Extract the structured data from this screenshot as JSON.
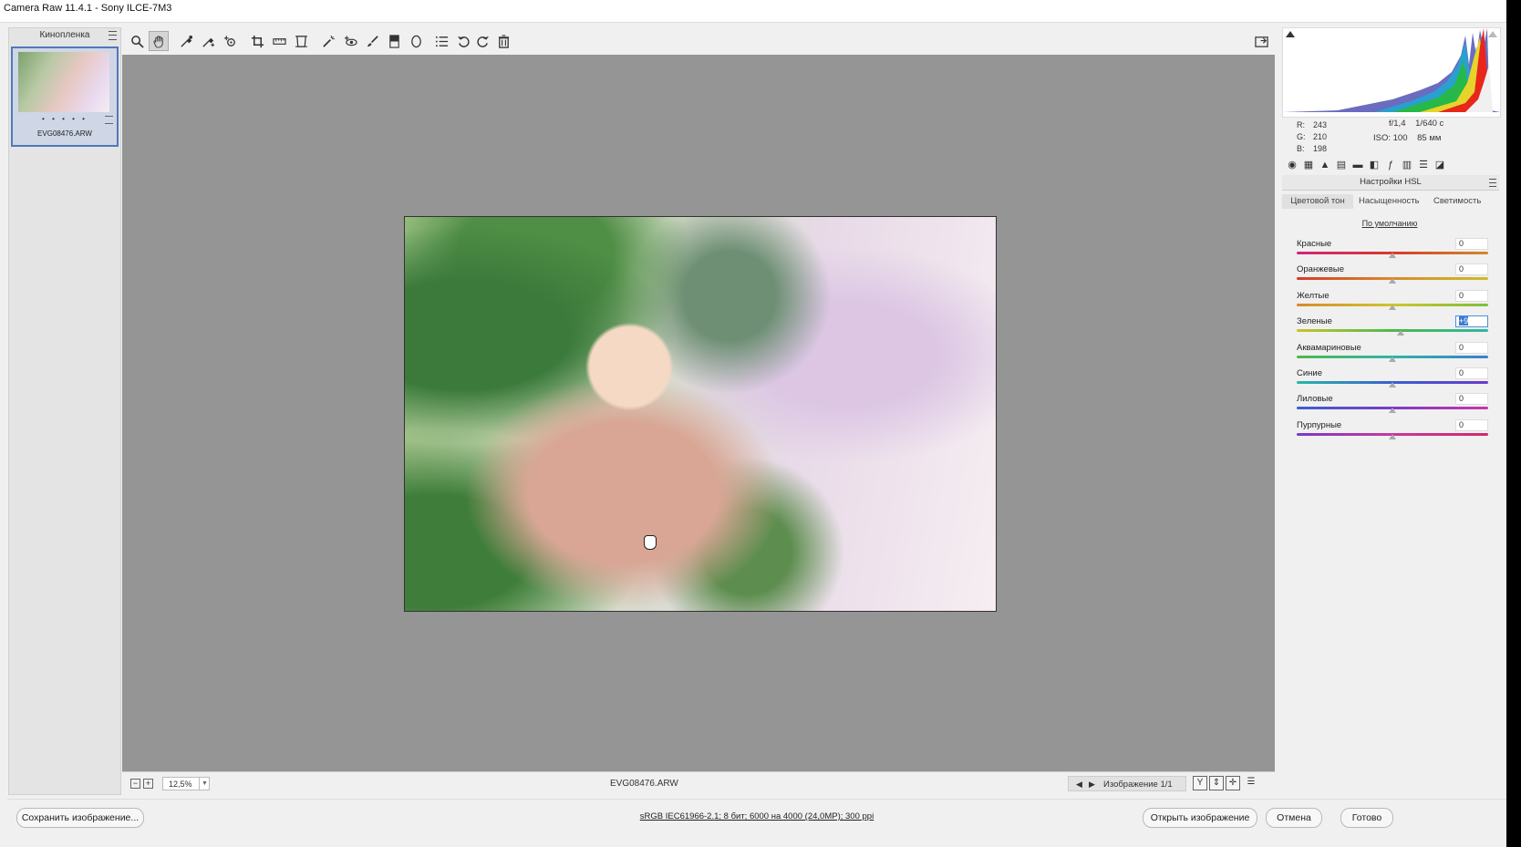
{
  "window": {
    "title": "Camera Raw 11.4.1  -  Sony ILCE-7M3"
  },
  "filmstrip": {
    "header": "Кинопленка",
    "thumb": {
      "stars": "• • • • •",
      "filename": "EVG08476.ARW"
    }
  },
  "statusbar": {
    "zoom": "12,5%",
    "filename": "EVG08476.ARW",
    "image_counter": "Изображение 1/1"
  },
  "readout": {
    "r_label": "R:",
    "r": "243",
    "g_label": "G:",
    "g": "210",
    "b_label": "B:",
    "b": "198",
    "aperture": "f/1,4",
    "shutter": "1/640 с",
    "iso": "ISO: 100",
    "focal": "85 мм"
  },
  "hsl": {
    "title": "Настройки HSL",
    "tabs": [
      "Цветовой тон",
      "Насыщенность",
      "Светимость"
    ],
    "defaults": "По умолчанию",
    "sliders": [
      {
        "label": "Красные",
        "value": "0",
        "norm": 0.5
      },
      {
        "label": "Оранжевые",
        "value": "0",
        "norm": 0.5
      },
      {
        "label": "Желтые",
        "value": "0",
        "norm": 0.5
      },
      {
        "label": "Зеленые",
        "value": "+9",
        "norm": 0.545
      },
      {
        "label": "Аквамариновые",
        "value": "0",
        "norm": 0.5
      },
      {
        "label": "Синие",
        "value": "0",
        "norm": 0.5
      },
      {
        "label": "Лиловые",
        "value": "0",
        "norm": 0.5
      },
      {
        "label": "Пурпурные",
        "value": "0",
        "norm": 0.5
      }
    ],
    "gradients": [
      "linear-gradient(90deg,#d0267c,#d73a2b,#d28a2a)",
      "linear-gradient(90deg,#d33b2a,#da8a29,#cbbd2b)",
      "linear-gradient(90deg,#d88a2b,#cfc52c,#7bbf3a)",
      "linear-gradient(90deg,#c9c42c,#4fb84c,#2fb7a3)",
      "linear-gradient(90deg,#4cb84b,#2fb6a8,#3b7fd0)",
      "linear-gradient(90deg,#2ab6a8,#3a5fd0,#6a3ac8)",
      "linear-gradient(90deg,#3b5fd0,#7b3ac8,#c837a8)",
      "linear-gradient(90deg,#7a3ac8,#c8379f,#d0286a)"
    ]
  },
  "buttons": {
    "save": "Сохранить изображение...",
    "info": "sRGB IEC61966-2.1; 8 бит; 6000 на 4000 (24,0MP); 300 ppi",
    "open": "Открыть изображение",
    "cancel": "Отмена",
    "done": "Готово"
  },
  "toolbar_icons": [
    "zoom-tool-icon",
    "hand-tool-icon",
    "white-balance-icon",
    "color-sampler-icon",
    "targeted-adjustment-icon",
    "crop-tool-icon",
    "straighten-icon",
    "transform-icon",
    "spot-removal-icon",
    "red-eye-icon",
    "adjustment-brush-icon",
    "graduated-filter-icon",
    "radial-filter-icon",
    "presets-list-icon",
    "rotate-left-icon",
    "rotate-right-icon",
    "trash-icon",
    "fullscreen-icon"
  ]
}
